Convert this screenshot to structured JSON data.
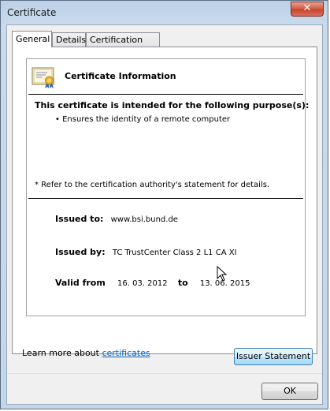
{
  "window": {
    "title": "Certificate",
    "close_glyph": "✕"
  },
  "tabs": [
    {
      "label": "General",
      "active": true
    },
    {
      "label": "Details",
      "active": false
    },
    {
      "label": "Certification Path",
      "active": false
    }
  ],
  "info": {
    "title": "Certificate Information",
    "purpose_heading": "This certificate is intended for the following purpose(s):",
    "purposes": [
      "• Ensures the identity of a remote computer"
    ],
    "note": "* Refer to the certification authority's statement for details.",
    "issued_to_label": "Issued to:",
    "issued_to_value": "www.bsi.bund.de",
    "issued_by_label": "Issued by:",
    "issued_by_value": "TC TrustCenter Class 2 L1 CA XI",
    "valid_from_label": "Valid from",
    "valid_from_value": "16. 03. 2012",
    "valid_to_label": "to",
    "valid_to_value": "13. 06. 2015"
  },
  "buttons": {
    "issuer_statement": "Issuer Statement",
    "ok": "OK"
  },
  "learn_more": {
    "prefix": "Learn more about ",
    "link": "certificates"
  },
  "icons": {
    "certificate": "certificate-icon",
    "cursor": "mouse-pointer-icon"
  }
}
